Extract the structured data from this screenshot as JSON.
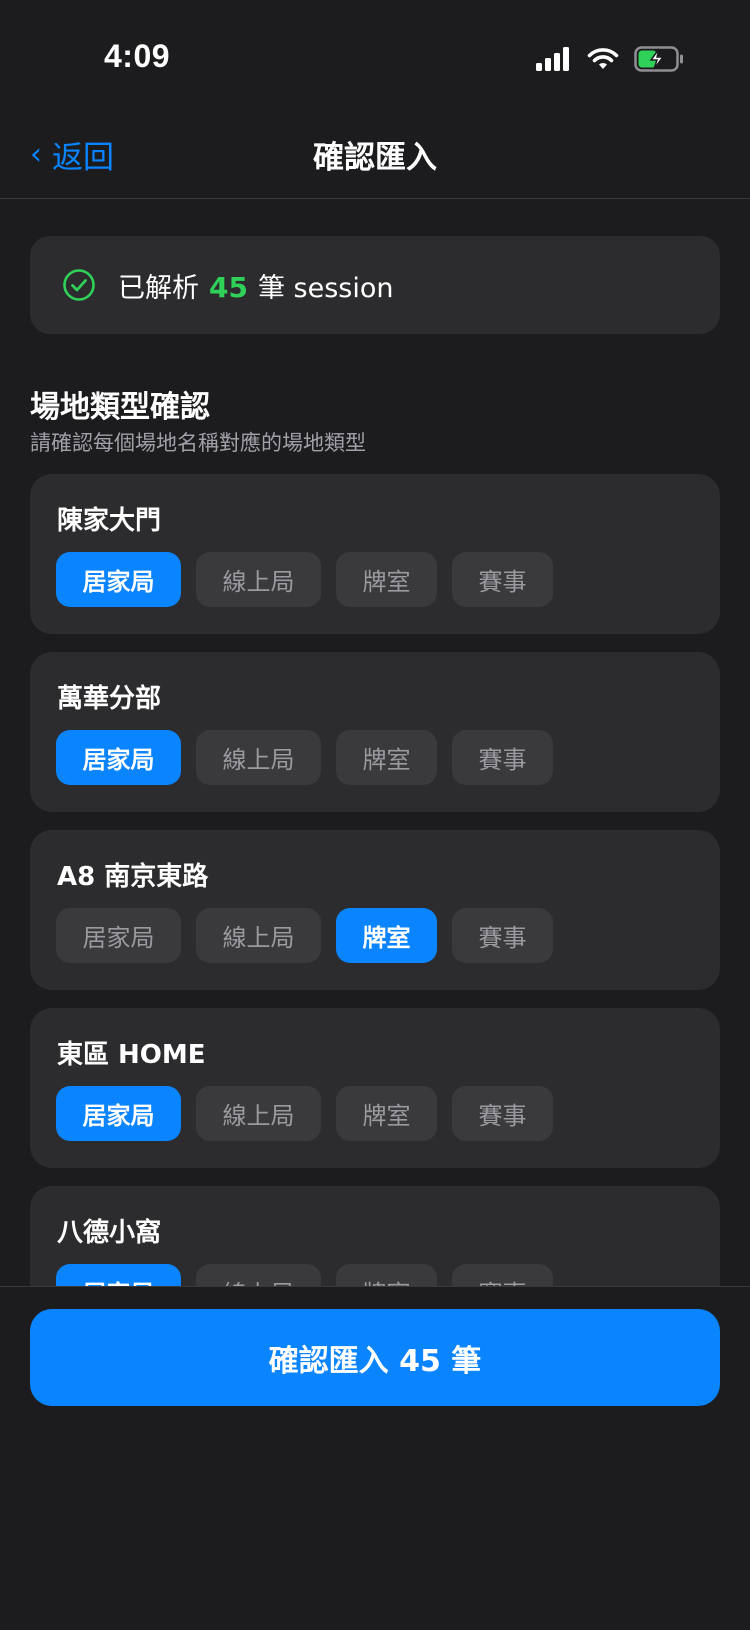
{
  "status_bar": {
    "time": "4:09"
  },
  "nav": {
    "back_label": "返回",
    "title": "確認匯入"
  },
  "summary": {
    "prefix": "已解析",
    "count": "45",
    "suffix": "筆 session",
    "icon": "check-circle-icon"
  },
  "section": {
    "title": "場地類型確認",
    "subtitle": "請確認每個場地名稱對應的場地類型"
  },
  "type_options": [
    "居家局",
    "線上局",
    "牌室",
    "賽事"
  ],
  "venues": [
    {
      "name": "陳家大門",
      "selected_type": "居家局"
    },
    {
      "name": "萬華分部",
      "selected_type": "居家局"
    },
    {
      "name": "A8 南京東路",
      "selected_type": "牌室"
    },
    {
      "name": "東區 HOME",
      "selected_type": "居家局"
    },
    {
      "name": "八德小窩",
      "selected_type": "居家局"
    }
  ],
  "confirm_button": {
    "label": "確認匯入 45 筆"
  },
  "colors": {
    "accent": "#0a84ff",
    "success": "#30d158",
    "background": "#1c1c1e",
    "card": "#2c2c2e",
    "chip": "#3a3a3c"
  }
}
